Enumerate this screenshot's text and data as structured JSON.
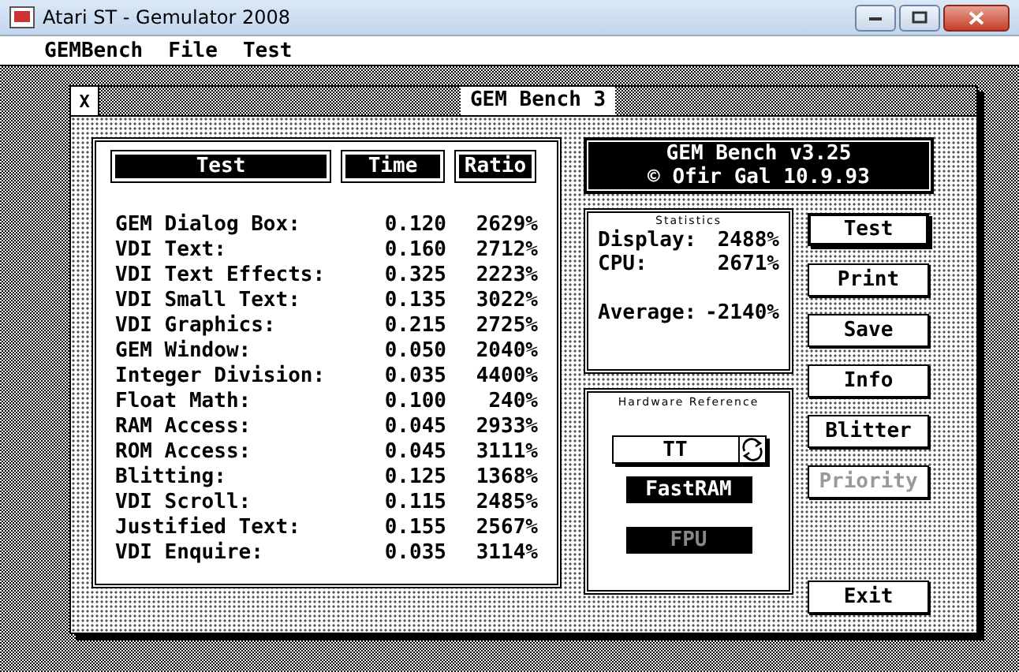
{
  "window": {
    "title": "Atari ST - Gemulator 2008"
  },
  "menu": [
    "GEMBench",
    "File",
    "Test"
  ],
  "dialog": {
    "title": "GEM Bench 3",
    "close": "X"
  },
  "results": {
    "columns": [
      "Test",
      "Time",
      "Ratio"
    ],
    "rows": [
      {
        "test": "GEM Dialog Box:",
        "time": "0.120",
        "ratio": "2629%"
      },
      {
        "test": "VDI Text:",
        "time": "0.160",
        "ratio": "2712%"
      },
      {
        "test": "VDI Text Effects:",
        "time": "0.325",
        "ratio": "2223%"
      },
      {
        "test": "VDI Small Text:",
        "time": "0.135",
        "ratio": "3022%"
      },
      {
        "test": "VDI Graphics:",
        "time": "0.215",
        "ratio": "2725%"
      },
      {
        "test": "GEM Window:",
        "time": "0.050",
        "ratio": "2040%"
      },
      {
        "test": "Integer Division:",
        "time": "0.035",
        "ratio": "4400%"
      },
      {
        "test": "Float Math:",
        "time": "0.100",
        "ratio": "240%"
      },
      {
        "test": "RAM Access:",
        "time": "0.045",
        "ratio": "2933%"
      },
      {
        "test": "ROM Access:",
        "time": "0.045",
        "ratio": "3111%"
      },
      {
        "test": "Blitting:",
        "time": "0.125",
        "ratio": "1368%"
      },
      {
        "test": "VDI Scroll:",
        "time": "0.115",
        "ratio": "2485%"
      },
      {
        "test": "Justified Text:",
        "time": "0.155",
        "ratio": "2567%"
      },
      {
        "test": "VDI Enquire:",
        "time": "0.035",
        "ratio": "3114%"
      }
    ]
  },
  "banner": [
    "GEM Bench v3.25",
    "© Ofir Gal 10.9.93"
  ],
  "statistics": {
    "title": "Statistics",
    "lines": [
      {
        "label": "Display:",
        "value": "2488%"
      },
      {
        "label": "CPU:",
        "value": "2671%"
      },
      {
        "label": "Average:",
        "value": "-2140%"
      }
    ]
  },
  "hardware": {
    "title": "Hardware Reference",
    "machine": "TT",
    "flags": [
      {
        "label": "FastRAM",
        "disabled": false
      },
      {
        "label": "FPU",
        "disabled": true
      }
    ]
  },
  "buttons": [
    {
      "label": "Test",
      "disabled": false,
      "default": true
    },
    {
      "label": "Print",
      "disabled": false,
      "default": false
    },
    {
      "label": "Save",
      "disabled": false,
      "default": false
    },
    {
      "label": "Info",
      "disabled": false,
      "default": false
    },
    {
      "label": "Blitter",
      "disabled": false,
      "default": false
    },
    {
      "label": "Priority",
      "disabled": true,
      "default": false
    },
    {
      "label": "Exit",
      "disabled": false,
      "default": false
    }
  ]
}
